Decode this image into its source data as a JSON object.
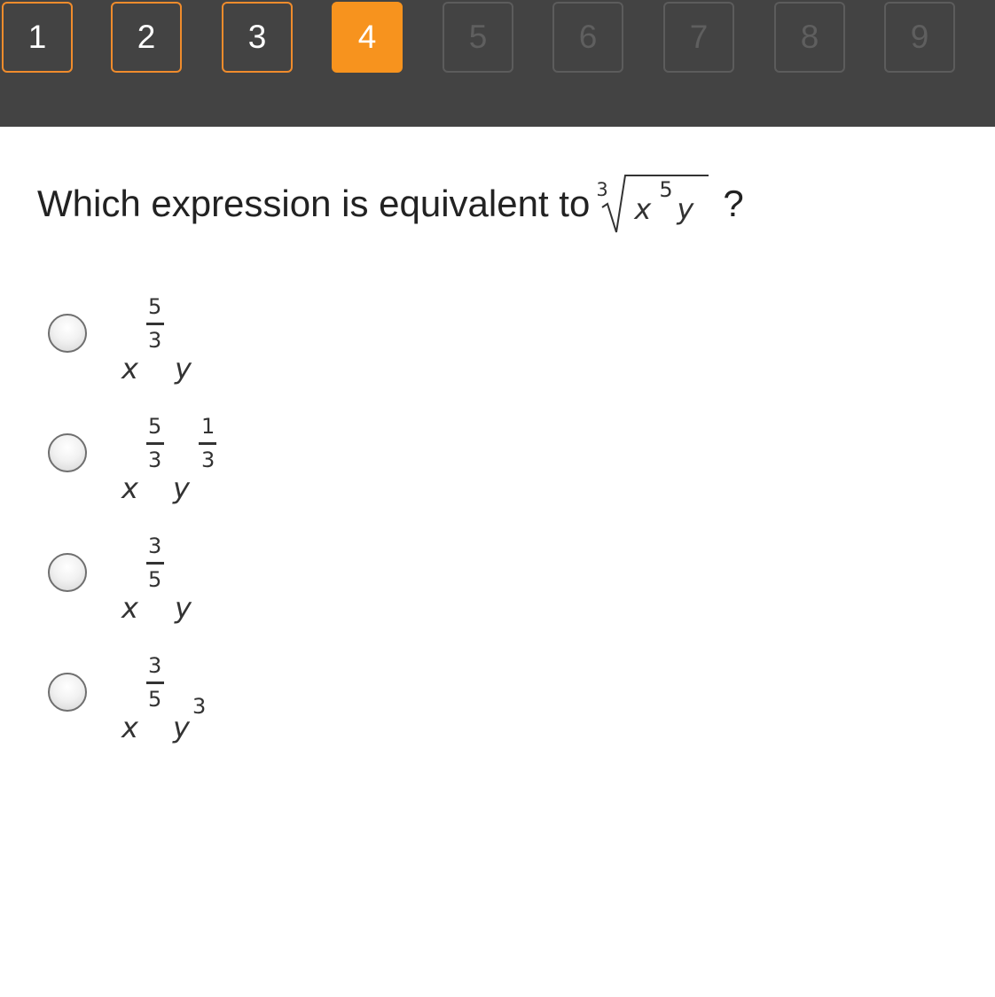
{
  "nav": {
    "buttons": [
      {
        "label": "1",
        "state": "answered"
      },
      {
        "label": "2",
        "state": "answered"
      },
      {
        "label": "3",
        "state": "answered"
      },
      {
        "label": "4",
        "state": "current"
      },
      {
        "label": "5",
        "state": "locked"
      },
      {
        "label": "6",
        "state": "locked"
      },
      {
        "label": "7",
        "state": "locked"
      },
      {
        "label": "8",
        "state": "locked"
      },
      {
        "label": "9",
        "state": "locked"
      }
    ]
  },
  "question": {
    "text": "Which expression is equivalent to",
    "expression": {
      "root_index": "3",
      "base": "x",
      "base_exponent": "5",
      "second": "y"
    },
    "end_mark": "?"
  },
  "options": [
    {
      "base": "x",
      "exp_num": "5",
      "exp_den": "3",
      "second": "y",
      "second_exp": "",
      "second_exp_num": "",
      "second_exp_den": ""
    },
    {
      "base": "x",
      "exp_num": "5",
      "exp_den": "3",
      "second": "y",
      "second_exp": "",
      "second_exp_num": "1",
      "second_exp_den": "3"
    },
    {
      "base": "x",
      "exp_num": "3",
      "exp_den": "5",
      "second": "y",
      "second_exp": "",
      "second_exp_num": "",
      "second_exp_den": ""
    },
    {
      "base": "x",
      "exp_num": "3",
      "exp_den": "5",
      "second": "y",
      "second_exp": "3",
      "second_exp_num": "",
      "second_exp_den": ""
    }
  ],
  "colors": {
    "nav_background": "#434343",
    "accent_orange": "#f7931e",
    "locked_border": "#5c5c5c",
    "text": "#222222"
  }
}
